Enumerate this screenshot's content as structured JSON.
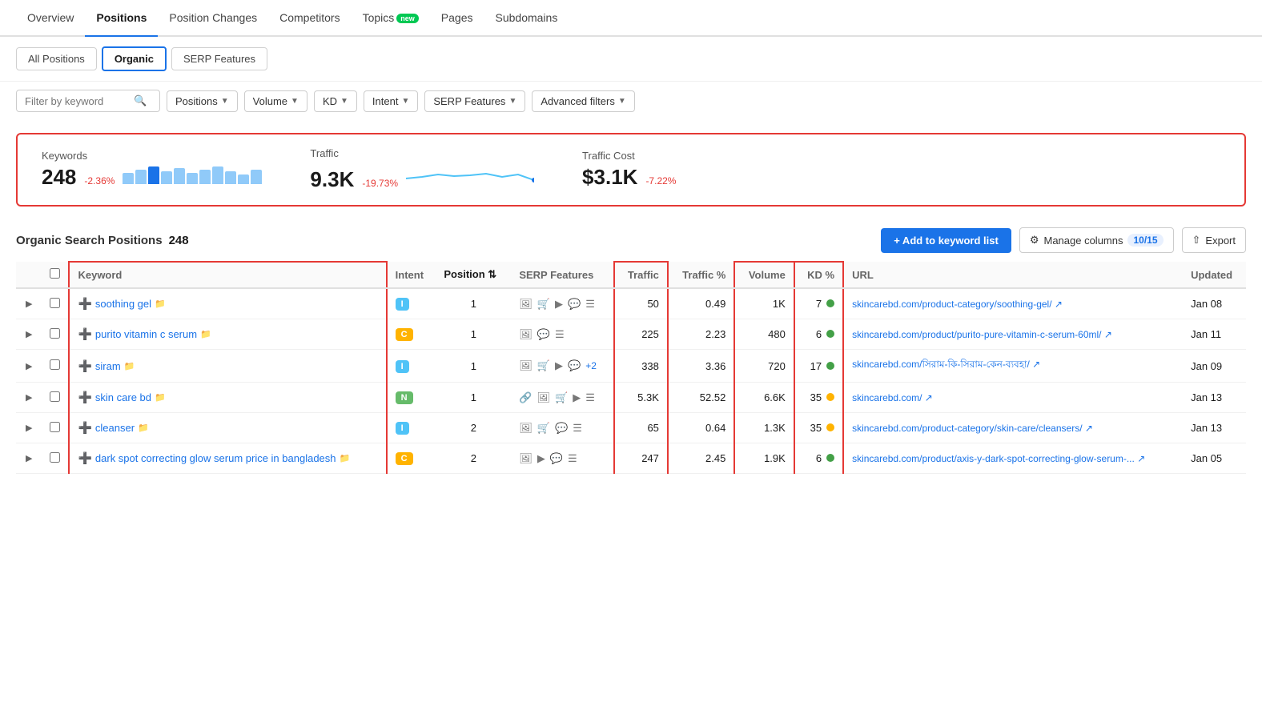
{
  "nav": {
    "items": [
      {
        "label": "Overview",
        "active": false
      },
      {
        "label": "Positions",
        "active": true
      },
      {
        "label": "Position Changes",
        "active": false
      },
      {
        "label": "Competitors",
        "active": false
      },
      {
        "label": "Topics",
        "active": false,
        "badge": "new"
      },
      {
        "label": "Pages",
        "active": false
      },
      {
        "label": "Subdomains",
        "active": false
      }
    ]
  },
  "sub_tabs": [
    {
      "label": "All Positions",
      "active": false
    },
    {
      "label": "Organic",
      "active": true
    },
    {
      "label": "SERP Features",
      "active": false
    }
  ],
  "filters": {
    "search_placeholder": "Filter by keyword",
    "buttons": [
      "Positions",
      "Volume",
      "KD",
      "Intent",
      "SERP Features",
      "Advanced filters"
    ]
  },
  "summary": {
    "keywords": {
      "label": "Keywords",
      "value": "248",
      "change": "-2.36%"
    },
    "traffic": {
      "label": "Traffic",
      "value": "9.3K",
      "change": "-19.73%"
    },
    "traffic_cost": {
      "label": "Traffic Cost",
      "value": "$3.1K",
      "change": "-7.22%"
    }
  },
  "table": {
    "title": "Organic Search Positions",
    "count": "248",
    "add_keyword_btn": "+ Add to keyword list",
    "manage_cols_btn": "Manage columns",
    "manage_cols_count": "10/15",
    "export_btn": "Export",
    "columns": [
      "Keyword",
      "Intent",
      "Position",
      "SERP Features",
      "Traffic",
      "Traffic %",
      "Volume",
      "KD %",
      "URL",
      "Updated"
    ],
    "rows": [
      {
        "keyword": "soothing gel",
        "keyword_url": "#",
        "intent": "I",
        "intent_type": "i",
        "position": "1",
        "serp_features": [
          "image",
          "shopping",
          "video",
          "snippet",
          "list"
        ],
        "traffic": "50",
        "traffic_pct": "0.49",
        "volume": "1K",
        "kd": "7",
        "kd_color": "green",
        "url": "skincarebd.com/product-category/soothing-gel/",
        "updated": "Jan 08"
      },
      {
        "keyword": "purito vitamin c serum",
        "keyword_url": "#",
        "intent": "C",
        "intent_type": "c",
        "position": "1",
        "serp_features": [
          "image",
          "snippet",
          "list"
        ],
        "traffic": "225",
        "traffic_pct": "2.23",
        "volume": "480",
        "kd": "6",
        "kd_color": "green",
        "url": "skincarebd.com/product/purito-pure-vitamin-c-serum-60ml/",
        "updated": "Jan 11"
      },
      {
        "keyword": "siram",
        "keyword_url": "#",
        "intent": "I",
        "intent_type": "i",
        "position": "1",
        "serp_features": [
          "image",
          "shopping",
          "video",
          "snippet",
          "+2"
        ],
        "traffic": "338",
        "traffic_pct": "3.36",
        "volume": "720",
        "kd": "17",
        "kd_color": "green",
        "url": "skincarebd.com/সিরাম-কি-সিরাম-কেন-ব্যবহা/",
        "updated": "Jan 09"
      },
      {
        "keyword": "skin care bd",
        "keyword_url": "#",
        "intent": "N",
        "intent_type": "n",
        "position": "1",
        "serp_features": [
          "link",
          "image",
          "shopping",
          "video",
          "list"
        ],
        "traffic": "5.3K",
        "traffic_pct": "52.52",
        "volume": "6.6K",
        "kd": "35",
        "kd_color": "yellow",
        "url": "skincarebd.com/",
        "updated": "Jan 13"
      },
      {
        "keyword": "cleanser",
        "keyword_url": "#",
        "intent": "I",
        "intent_type": "i",
        "position": "2",
        "serp_features": [
          "image",
          "shopping",
          "snippet",
          "list"
        ],
        "traffic": "65",
        "traffic_pct": "0.64",
        "volume": "1.3K",
        "kd": "35",
        "kd_color": "yellow",
        "url": "skincarebd.com/product-category/skin-care/cleansers/",
        "updated": "Jan 13"
      },
      {
        "keyword": "dark spot correcting glow serum price in bangladesh",
        "keyword_url": "#",
        "intent": "C",
        "intent_type": "c",
        "position": "2",
        "serp_features": [
          "image",
          "video",
          "snippet",
          "list"
        ],
        "traffic": "247",
        "traffic_pct": "2.45",
        "volume": "1.9K",
        "kd": "6",
        "kd_color": "green",
        "url": "skincarebd.com/product/axis-y-dark-spot-correcting-glow-serum-...",
        "updated": "Jan 05"
      }
    ]
  }
}
